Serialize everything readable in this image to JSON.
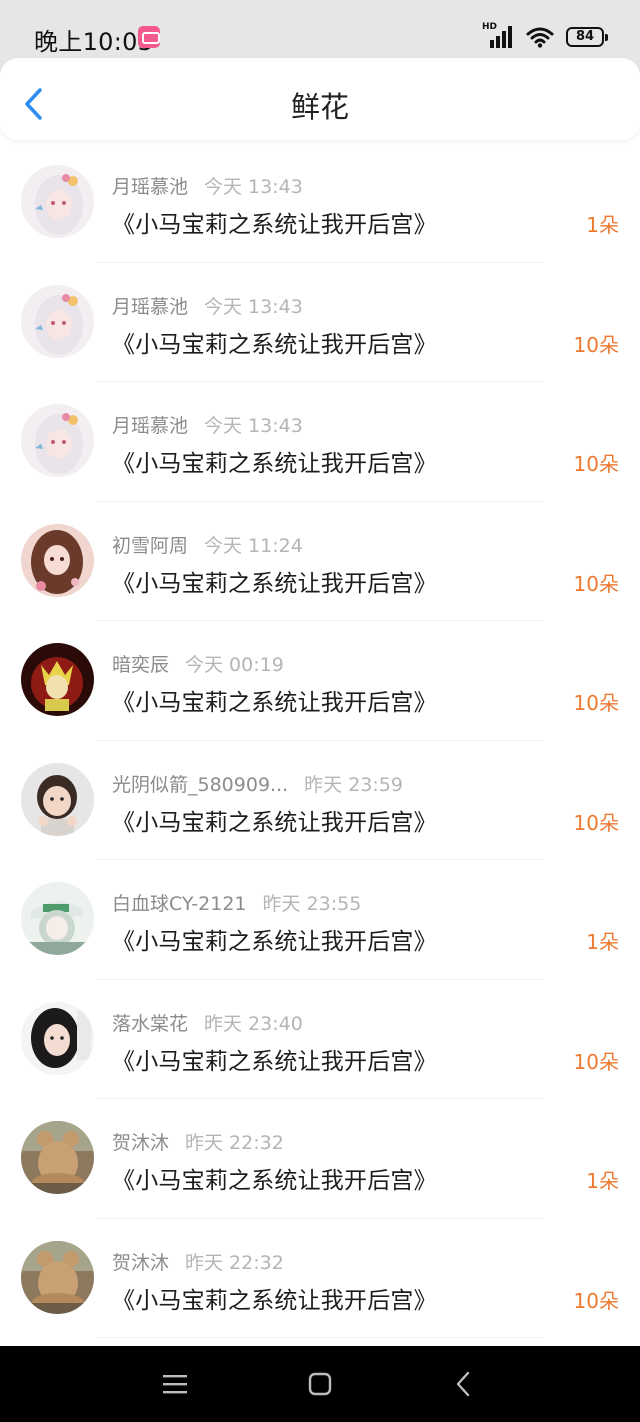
{
  "status_bar": {
    "time": "晚上10:03",
    "network_label": "HD",
    "battery": "84",
    "icons": [
      "app-badge-icon",
      "signal-icon",
      "wifi-icon",
      "battery-icon"
    ]
  },
  "header": {
    "title": "鲜花",
    "back_icon": "chevron-left-icon"
  },
  "accent_colors": {
    "back": "#2d8cf0",
    "count": "#ee7a32"
  },
  "records": [
    {
      "user": "月瑶慕池",
      "time": "今天 13:43",
      "book": "《小马宝莉之系统让我开后宫》",
      "count": "1朵",
      "avatar": "anime-girl-white-hair"
    },
    {
      "user": "月瑶慕池",
      "time": "今天 13:43",
      "book": "《小马宝莉之系统让我开后宫》",
      "count": "10朵",
      "avatar": "anime-girl-white-hair"
    },
    {
      "user": "月瑶慕池",
      "time": "今天 13:43",
      "book": "《小马宝莉之系统让我开后宫》",
      "count": "10朵",
      "avatar": "anime-girl-white-hair"
    },
    {
      "user": "初雪阿周",
      "time": "今天 11:24",
      "book": "《小马宝莉之系统让我开后宫》",
      "count": "10朵",
      "avatar": "anime-girl-brown-hair"
    },
    {
      "user": "暗奕辰",
      "time": "今天 00:19",
      "book": "《小马宝莉之系统让我开后宫》",
      "count": "10朵",
      "avatar": "anime-red-dark"
    },
    {
      "user": "光阴似箭_580909...",
      "time": "昨天 23:59",
      "book": "《小马宝莉之系统让我开后宫》",
      "count": "10朵",
      "avatar": "child-photo"
    },
    {
      "user": "白血球CY-2121",
      "time": "昨天 23:55",
      "book": "《小马宝莉之系统让我开后宫》",
      "count": "1朵",
      "avatar": "anime-cap-green"
    },
    {
      "user": "落水棠花",
      "time": "昨天 23:40",
      "book": "《小马宝莉之系统让我开后宫》",
      "count": "10朵",
      "avatar": "girl-photo"
    },
    {
      "user": "贺沐沐",
      "time": "昨天 22:32",
      "book": "《小马宝莉之系统让我开后宫》",
      "count": "1朵",
      "avatar": "teddy-bear"
    },
    {
      "user": "贺沐沐",
      "time": "昨天 22:32",
      "book": "《小马宝莉之系统让我开后宫》",
      "count": "10朵",
      "avatar": "teddy-bear"
    }
  ],
  "nav_bar": {
    "buttons": [
      "menu-icon",
      "home-icon",
      "back-icon"
    ]
  }
}
